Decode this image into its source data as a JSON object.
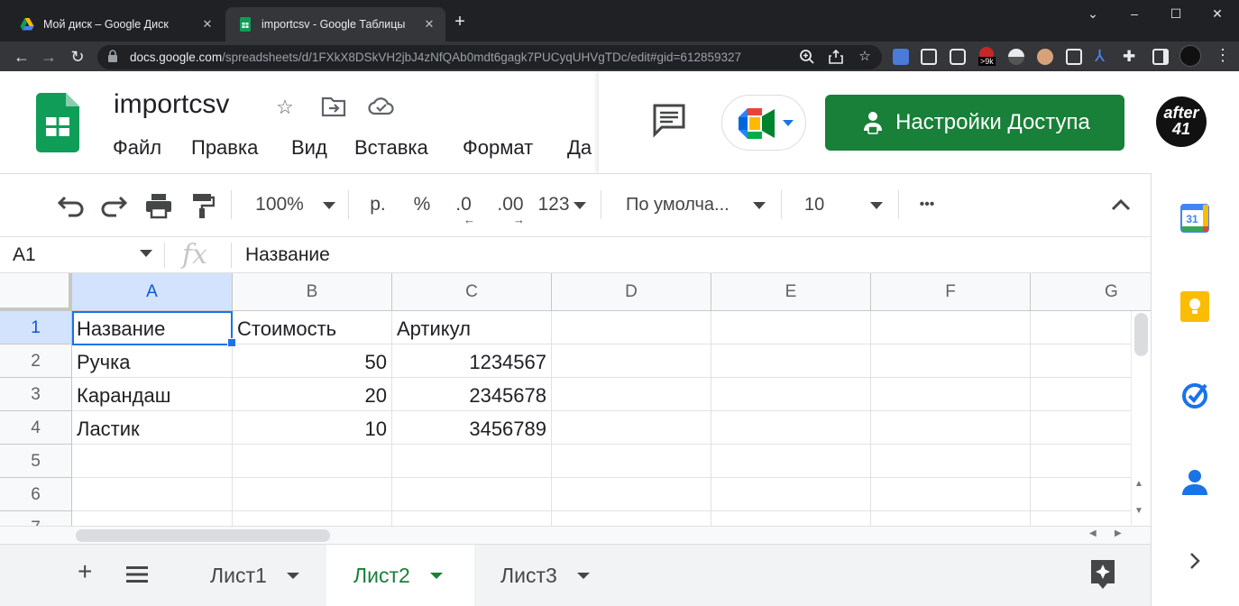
{
  "browser": {
    "tabs": [
      {
        "title": "Мой диск – Google Диск",
        "icon": "google-drive-icon"
      },
      {
        "title": "importcsv - Google Таблицы",
        "icon": "google-sheets-icon"
      }
    ],
    "new_tab": "+",
    "window": {
      "minimize": "–",
      "maximize": "☐",
      "close": "✕",
      "dropdown": "⌄"
    },
    "url_host": "docs.google.com",
    "url_path": "/spreadsheets/d/1FXkX8DSkVH2jbJ4zNfQAb0mdt6gagk7PUCyqUHVgTDc/edit#gid=612859327",
    "extension_badge": ">9k"
  },
  "sheets": {
    "doc_title": "importcsv",
    "menu": [
      "Файл",
      "Правка",
      "Вид",
      "Вставка",
      "Формат",
      "Да"
    ],
    "share_label": "Настройки Доступа",
    "avatar_text": "after 41",
    "brand_color": "#188038",
    "accent_color": "#1a73e8"
  },
  "toolbar": {
    "zoom": "100%",
    "currency": "р.",
    "percent": "%",
    "dec_decrease": ".0",
    "dec_increase": ".00",
    "number_format": "123",
    "font": "По умолча...",
    "font_size": "10",
    "more": "•••"
  },
  "formula_bar": {
    "name_box": "A1",
    "fx": "fx",
    "value": "Название"
  },
  "grid": {
    "columns": [
      "A",
      "B",
      "C",
      "D",
      "E",
      "F",
      "G"
    ],
    "rows": [
      "1",
      "2",
      "3",
      "4",
      "5",
      "6",
      "7"
    ],
    "cells": [
      [
        "Название",
        "Стоимость",
        "Артикул"
      ],
      [
        "Ручка",
        "50",
        "1234567"
      ],
      [
        "Карандаш",
        "20",
        "2345678"
      ],
      [
        "Ластик",
        "10",
        "3456789"
      ]
    ]
  },
  "sheet_tabs": [
    "Лист1",
    "Лист2",
    "Лист3"
  ],
  "active_sheet": "Лист2"
}
